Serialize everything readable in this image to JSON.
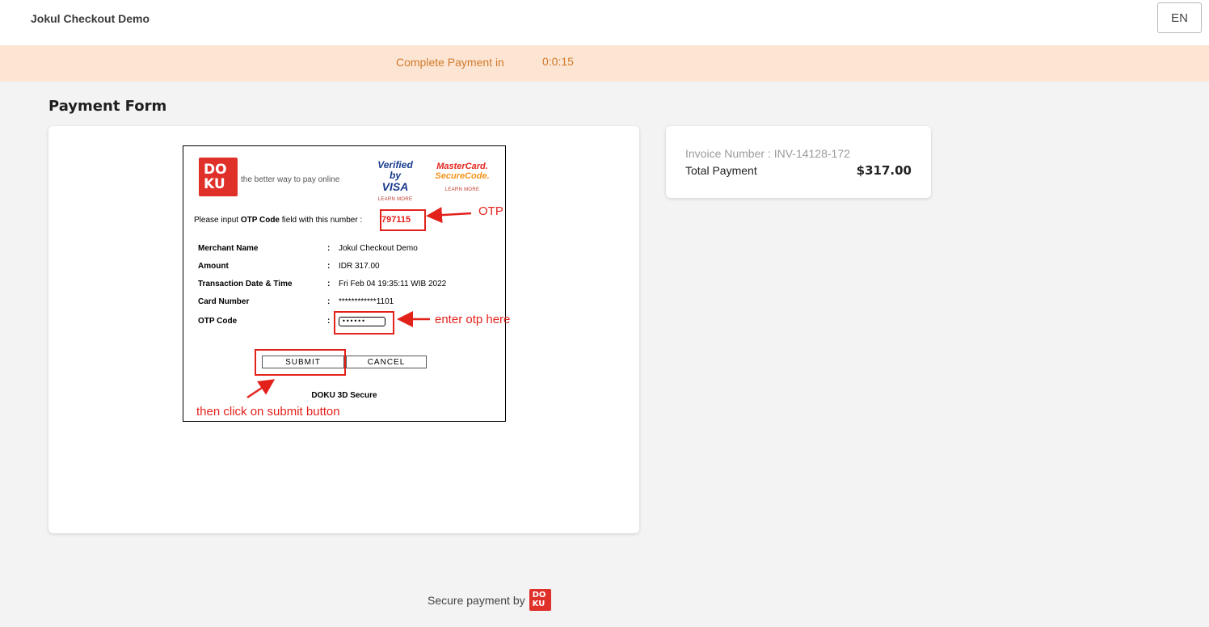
{
  "header": {
    "app_title": "Jokul Checkout Demo",
    "language": "EN"
  },
  "timer": {
    "label": "Complete Payment in",
    "value": "0:0:15"
  },
  "page": {
    "heading": "Payment Form"
  },
  "secure_frame": {
    "doku_logo_text": [
      "DO",
      "KU"
    ],
    "tagline": "the better way to pay online",
    "visa": {
      "line1": "Verified by",
      "line2": "VISA",
      "learn_more": "LEARN MORE"
    },
    "mastercard": {
      "line1": "MasterCard.",
      "line2": "SecureCode.",
      "learn_more": "LEARN MORE"
    },
    "otp_instruction_prefix": "Please input ",
    "otp_instruction_bold": "OTP Code",
    "otp_instruction_suffix": " field with this number : ",
    "otp_number": "797115",
    "fields": [
      {
        "label": "Merchant Name",
        "colon": ":",
        "value": "Jokul Checkout Demo"
      },
      {
        "label": "Amount",
        "colon": ":",
        "value": "IDR 317.00"
      },
      {
        "label": "Transaction Date & Time",
        "colon": ":",
        "value": "Fri Feb 04 19:35:11 WIB 2022"
      },
      {
        "label": "Card Number",
        "colon": ":",
        "value": "************1101"
      }
    ],
    "otp_field": {
      "label": "OTP Code",
      "colon": ":",
      "value": "••••••"
    },
    "submit_label": "SUBMIT",
    "cancel_label": "CANCEL",
    "secure_label": "DOKU 3D Secure"
  },
  "annotations": {
    "otp": "OTP",
    "enter_otp": "enter otp here",
    "click_submit": "then click on submit button",
    "color": "#e3211b"
  },
  "invoice": {
    "number_label": "Invoice Number : INV-14128-172",
    "total_label": "Total Payment",
    "total_value": "$317.00"
  },
  "footer": {
    "text": "Secure payment by",
    "logo_text": [
      "DO",
      "KU"
    ]
  },
  "colors": {
    "brand_red": "#e0302a",
    "timer_bg": "#fde5d3",
    "timer_text": "#d07a2c"
  }
}
